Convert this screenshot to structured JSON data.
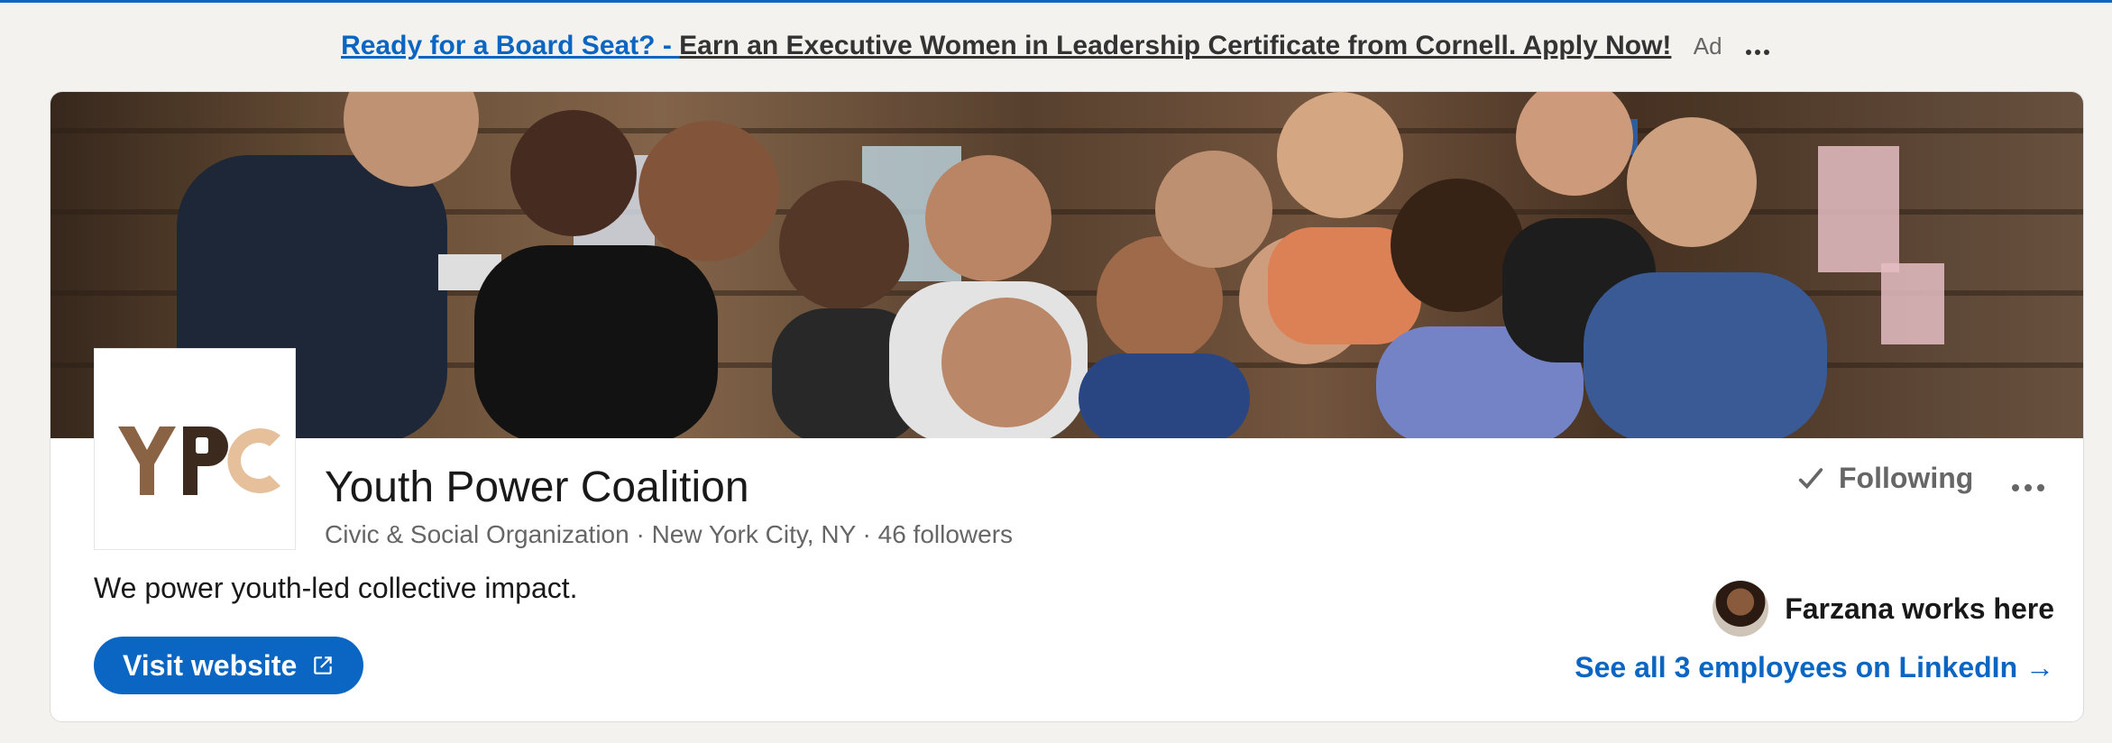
{
  "ad": {
    "link_text": "Ready for a Board Seat? - ",
    "body_text": "Earn an Executive Women in Leadership Certificate from Cornell. Apply Now!",
    "label": "Ad",
    "more_icon": "more-horizontal-icon"
  },
  "company": {
    "logo_text": "YPC",
    "name": "Youth Power Coalition",
    "meta": "Civic & Social Organization · New York City, NY · 46 followers",
    "tagline": "We power youth-led collective impact.",
    "visit_label": "Visit website",
    "following_label": "Following",
    "employee_text": "Farzana works here",
    "see_all_label": "See all 3 employees on LinkedIn →"
  },
  "colors": {
    "brand_blue": "#0a66c2",
    "logo_brown": "#8a6244",
    "logo_dark": "#3d2a1f",
    "logo_tan": "#e6c09a"
  },
  "icons": {
    "following": "checkmark-icon",
    "visit": "external-link-icon",
    "more": "more-horizontal-icon"
  }
}
